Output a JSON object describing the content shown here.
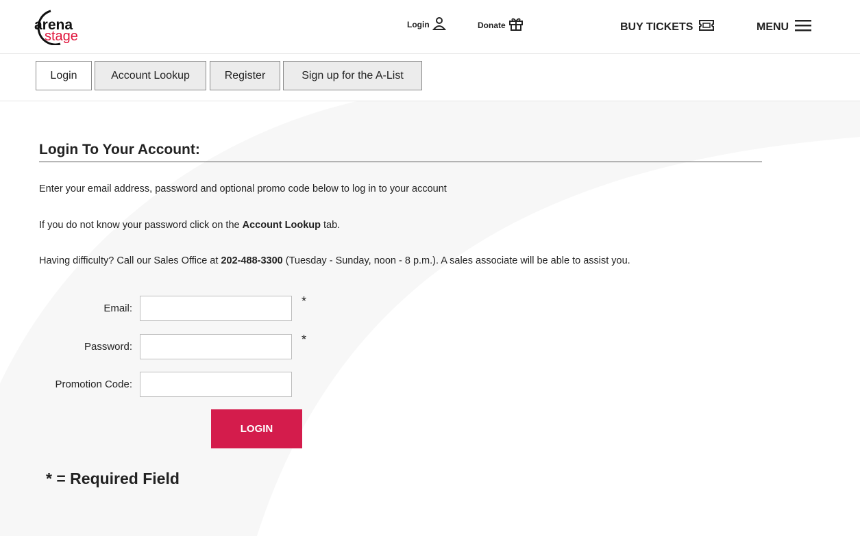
{
  "logo": {
    "line1": "arena",
    "line2": "stage"
  },
  "header": {
    "login_label": "Login",
    "donate_label": "Donate",
    "buy_tickets_label": "BUY TICKETS",
    "menu_label": "MENU"
  },
  "tabs": [
    {
      "label": "Login",
      "active": true
    },
    {
      "label": "Account Lookup",
      "active": false
    },
    {
      "label": "Register",
      "active": false
    },
    {
      "label": "Sign up for the A-List",
      "active": false
    }
  ],
  "main": {
    "heading": "Login To Your Account:",
    "intro": "Enter your email address, password and optional promo code below to log in to your account",
    "lookup_prefix": "If you do not know your password click on the ",
    "lookup_bold": "Account Lookup",
    "lookup_suffix": " tab.",
    "help_prefix": "Having difficulty? Call our Sales Office at ",
    "help_phone": "202-488-3300",
    "help_suffix": " (Tuesday - Sunday, noon - 8 p.m.). A sales associate will be able to assist you."
  },
  "form": {
    "email_label": "Email:",
    "email_value": "",
    "password_label": "Password:",
    "password_value": "",
    "promo_label": "Promotion Code:",
    "promo_value": "",
    "required_mark": "*",
    "submit_label": "LOGIN"
  },
  "required_note": "* = Required Field",
  "colors": {
    "brand_red": "#d41c4c",
    "logo_red": "#e0153c",
    "text": "#222222"
  },
  "icons": {
    "login": "user-icon",
    "donate": "gift-icon",
    "buy_tickets": "ticket-icon",
    "menu": "hamburger-menu-icon"
  }
}
